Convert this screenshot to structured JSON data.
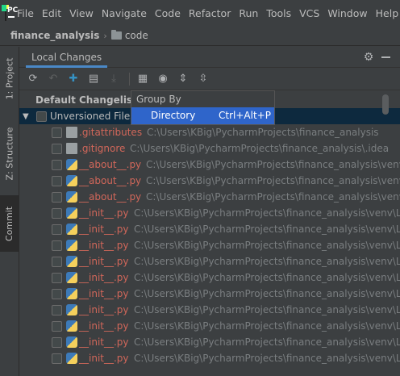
{
  "menubar": {
    "items": [
      "File",
      "Edit",
      "View",
      "Navigate",
      "Code",
      "Refactor",
      "Run",
      "Tools",
      "VCS",
      "Window",
      "Help"
    ]
  },
  "breadcrumb": {
    "project": "finance_analysis",
    "directory": "code"
  },
  "left_stripe": {
    "tabs": [
      "1: Project",
      "Z: Structure",
      "Commit"
    ]
  },
  "toolwindow": {
    "tab": "Local Changes",
    "changelist": "Default Changelist",
    "group": "Unversioned Files"
  },
  "popup": {
    "title": "Group By",
    "item_label": "Directory",
    "item_shortcut": "Ctrl+Alt+P"
  },
  "files": [
    {
      "name": ".gitattributes",
      "path": "C:\\Users\\KBig\\PycharmProjects\\finance_analysis",
      "icon": "git-file-icon"
    },
    {
      "name": ".gitignore",
      "path": "C:\\Users\\KBig\\PycharmProjects\\finance_analysis\\.idea",
      "icon": "gitignore-file-icon"
    },
    {
      "name": "__about__.py",
      "path": "C:\\Users\\KBig\\PycharmProjects\\finance_analysis\\venv",
      "icon": "python-file-icon"
    },
    {
      "name": "__about__.py",
      "path": "C:\\Users\\KBig\\PycharmProjects\\finance_analysis\\venv",
      "icon": "python-file-icon"
    },
    {
      "name": "__about__.py",
      "path": "C:\\Users\\KBig\\PycharmProjects\\finance_analysis\\venv",
      "icon": "python-file-icon"
    },
    {
      "name": "__init__.py",
      "path": "C:\\Users\\KBig\\PycharmProjects\\finance_analysis\\venv\\L",
      "icon": "python-file-icon"
    },
    {
      "name": "__init__.py",
      "path": "C:\\Users\\KBig\\PycharmProjects\\finance_analysis\\venv\\L",
      "icon": "python-file-icon"
    },
    {
      "name": "__init__.py",
      "path": "C:\\Users\\KBig\\PycharmProjects\\finance_analysis\\venv\\L",
      "icon": "python-file-icon"
    },
    {
      "name": "__init__.py",
      "path": "C:\\Users\\KBig\\PycharmProjects\\finance_analysis\\venv\\L",
      "icon": "python-file-icon"
    },
    {
      "name": "__init__.py",
      "path": "C:\\Users\\KBig\\PycharmProjects\\finance_analysis\\venv\\L",
      "icon": "python-file-icon"
    },
    {
      "name": "__init__.py",
      "path": "C:\\Users\\KBig\\PycharmProjects\\finance_analysis\\venv\\L",
      "icon": "python-file-icon"
    },
    {
      "name": "__init__.py",
      "path": "C:\\Users\\KBig\\PycharmProjects\\finance_analysis\\venv\\L",
      "icon": "python-file-icon"
    },
    {
      "name": "__init__.py",
      "path": "C:\\Users\\KBig\\PycharmProjects\\finance_analysis\\venv\\L",
      "icon": "python-file-icon"
    },
    {
      "name": "__init__.py",
      "path": "C:\\Users\\KBig\\PycharmProjects\\finance_analysis\\venv\\L",
      "icon": "python-file-icon"
    },
    {
      "name": "__init__.py",
      "path": "C:\\Users\\KBig\\PycharmProjects\\finance_analysis\\venv\\L",
      "icon": "python-file-icon"
    }
  ],
  "colors": {
    "background": "#3c3f41",
    "selection": "#0d293e",
    "popup_highlight": "#2f65ca",
    "unversioned_text": "#d1675a",
    "path_text": "#7a7e80",
    "tab_underline": "#4a88c7"
  }
}
